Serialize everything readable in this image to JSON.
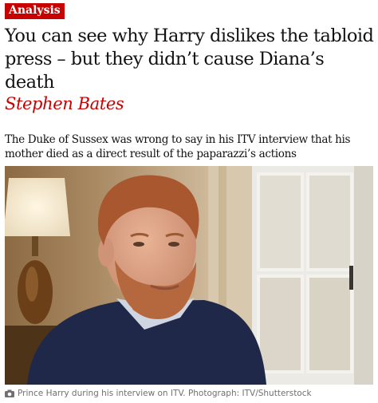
{
  "article": {
    "kicker": "Analysis",
    "headline": "You can see why Harry dislikes the tabloid press – but they didn’t cause Diana’s death",
    "byline": "Stephen Bates",
    "standfirst": "The Duke of Sussex was wrong to say in his ITV interview that his mother died as a direct result of the paparazzi’s actions",
    "caption": "Prince Harry during his interview on ITV. Photograph: ITV/Shutterstock",
    "caption_icon": "camera-icon"
  },
  "colors": {
    "accent_red": "#c70000",
    "text": "#121212",
    "caption_grey": "#707070"
  }
}
